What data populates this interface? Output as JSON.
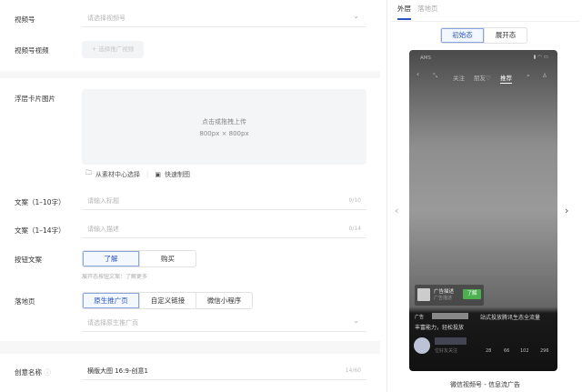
{
  "form": {
    "channel": {
      "label": "视频号",
      "placeholder": "请选择视频号"
    },
    "channel_video": {
      "label": "视频号视频",
      "button": "+ 选择推广视频"
    },
    "card_image": {
      "label": "浮层卡片图片",
      "upload_text": "点击或拖拽上传",
      "size": "800px × 800px",
      "link_library": "从素材中心选择",
      "link_quick": "快速制图"
    },
    "title": {
      "label": "文案（1–10字）",
      "placeholder": "请输入标题",
      "count": "0/10"
    },
    "desc": {
      "label": "文案（1–14字）",
      "placeholder": "请输入描述",
      "count": "0/14"
    },
    "button_text": {
      "label": "按钮文案",
      "options": [
        "了解",
        "购买"
      ],
      "selected": "了解",
      "hint": "展开态按钮文案：了解更多"
    },
    "landing": {
      "label": "落地页",
      "options": [
        "原生推广页",
        "自定义链接",
        "微信小程序"
      ],
      "selected": "原生推广页",
      "placeholder": "请选择原生推广页"
    },
    "creative_name": {
      "label": "创意名称",
      "value": "横版大图 16:9-创意1",
      "count": "14/60"
    }
  },
  "preview": {
    "tabs": [
      "外层",
      "落地页"
    ],
    "active_tab": "外层",
    "states": [
      "初始态",
      "展开态"
    ],
    "active_state": "初始态",
    "phone": {
      "carrier": "AMS",
      "nav": [
        "关注",
        "朋友♡",
        "推荐"
      ],
      "active_nav": "推荐",
      "card_title": "广告描述",
      "card_sub": "广告描述",
      "card_button": "了解",
      "ad_tag": "广告",
      "ad_text": "站式投放腾讯生态全流量",
      "ad_text2": "丰富能力，轻松投放",
      "follow_text": "位好友关注",
      "stats": [
        "28",
        "66",
        "102",
        "296"
      ]
    },
    "caption": "微信视频号 - 信息流广告"
  }
}
